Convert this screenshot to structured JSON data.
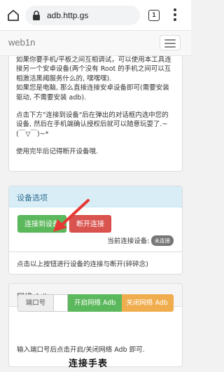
{
  "browser": {
    "url": "adb.http.gs",
    "tab_count": "1"
  },
  "navbar": {
    "brand": "web1n"
  },
  "intro": {
    "p1": "如果你要手机/平板之间互相调试，可以使用本工具连接另一个安卓设备(两个没有 Root 的手机之间可以互相激活黑阈服务什么的, 嘿嘿嘿).",
    "p2": "如果您是电脑, 那么直接连接安卓设备即可(需要安装驱动, 不需要安装 adb).",
    "p3": "点击下方\"连接到设备\"后在弹出的对话框内选中您的设备, 然后在手机端确认授权后就可以随意玩耍了.~(￣▽￣)~*",
    "p4": "使用完毕后记得断开设备哦."
  },
  "device_panel": {
    "title": "设备选项",
    "connect_label": "连接到设备",
    "disconnect_label": "断开连接",
    "status_label": "当前连接设备:",
    "status_badge": "未连接",
    "footer": "点击以上按钮进行设备的连接与断开(碎碎念)"
  },
  "adb_panel": {
    "title": "网络 Adb",
    "port_label": "端口号",
    "port_value": "",
    "open_label": "开启网络 Adb",
    "close_label": "关闭网络 Adb",
    "help": "输入端口号后点击开启/关闭网络 Adb 即可."
  },
  "overlay": {
    "caption": "连接手表"
  },
  "colors": {
    "success": "#5cb85c",
    "danger": "#d9534f",
    "warning": "#f0ad4e",
    "info_bg": "#d9edf7",
    "annotation_arrow": "#e53935"
  }
}
